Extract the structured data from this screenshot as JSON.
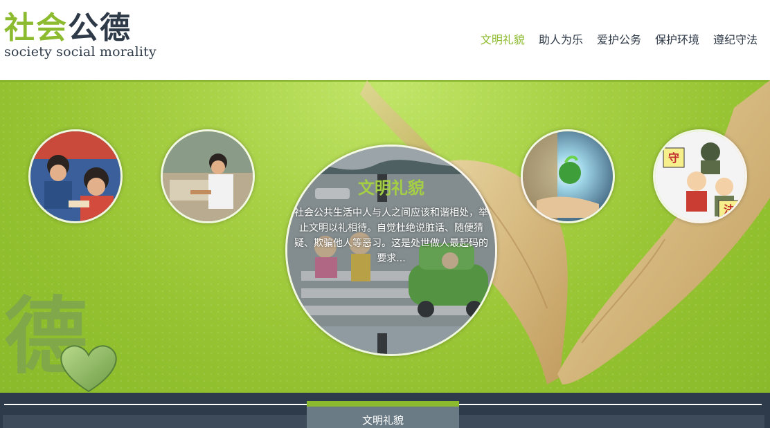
{
  "logo": {
    "cn_part1": "社会",
    "cn_part2": "公德",
    "en": "society social morality"
  },
  "nav": [
    {
      "label": "文明礼貌",
      "active": true
    },
    {
      "label": "助人为乐",
      "active": false
    },
    {
      "label": "爱护公务",
      "active": false
    },
    {
      "label": "保护环境",
      "active": false
    },
    {
      "label": "遵纪守法",
      "active": false
    }
  ],
  "banner": {
    "caption_title": "文明礼貌",
    "caption_text": "社会公共生活中人与人之间应该和谐相处，举止文明以礼相待。自觉杜绝说脏话、随便猜疑、欺骗他人等恶习。这是处世做人最起码的要求...",
    "decor_char": "德",
    "sign1": "守",
    "sign2": "法"
  },
  "footer": {
    "tab_label": "文明礼貌"
  },
  "colors": {
    "accent": "#8dbb2f",
    "dark": "#2f3a48",
    "banner": "#93c12f",
    "footer": "#2e3b4b"
  }
}
